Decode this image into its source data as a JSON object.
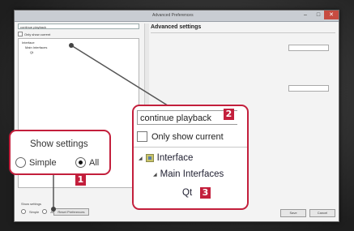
{
  "window": {
    "title": "Advanced Preferences",
    "min_icon": "minimize-icon",
    "max_icon": "maximize-icon",
    "close_icon": "close-icon"
  },
  "left_pane": {
    "search_value": "continue playback",
    "only_current_label": "Only show current",
    "tree": [
      "Interface",
      "Main Interfaces",
      "Qt"
    ]
  },
  "right_pane": {
    "title": "Advanced settings",
    "rows": [
      "",
      "",
      "",
      "",
      "",
      "",
      "",
      "",
      "",
      ""
    ]
  },
  "bottom_bar": {
    "show_settings_label": "Show settings",
    "simple_label": "Simple",
    "all_label": "All",
    "reset_label": "Reset Preferences",
    "save_label": "Save",
    "cancel_label": "Cancel"
  },
  "callout_show_settings": {
    "heading": "Show settings",
    "simple": "Simple",
    "all": "All",
    "selected": "All",
    "badge": "1"
  },
  "callout_search": {
    "input_value": "continue playback",
    "only_current": "Only show current",
    "tree": {
      "interface": "Interface",
      "main_interfaces": "Main Interfaces",
      "qt": "Qt"
    },
    "badge_search": "2",
    "badge_qt": "3"
  },
  "colors": {
    "accent": "#c31f3c",
    "window_bg": "#f3f3f3"
  }
}
